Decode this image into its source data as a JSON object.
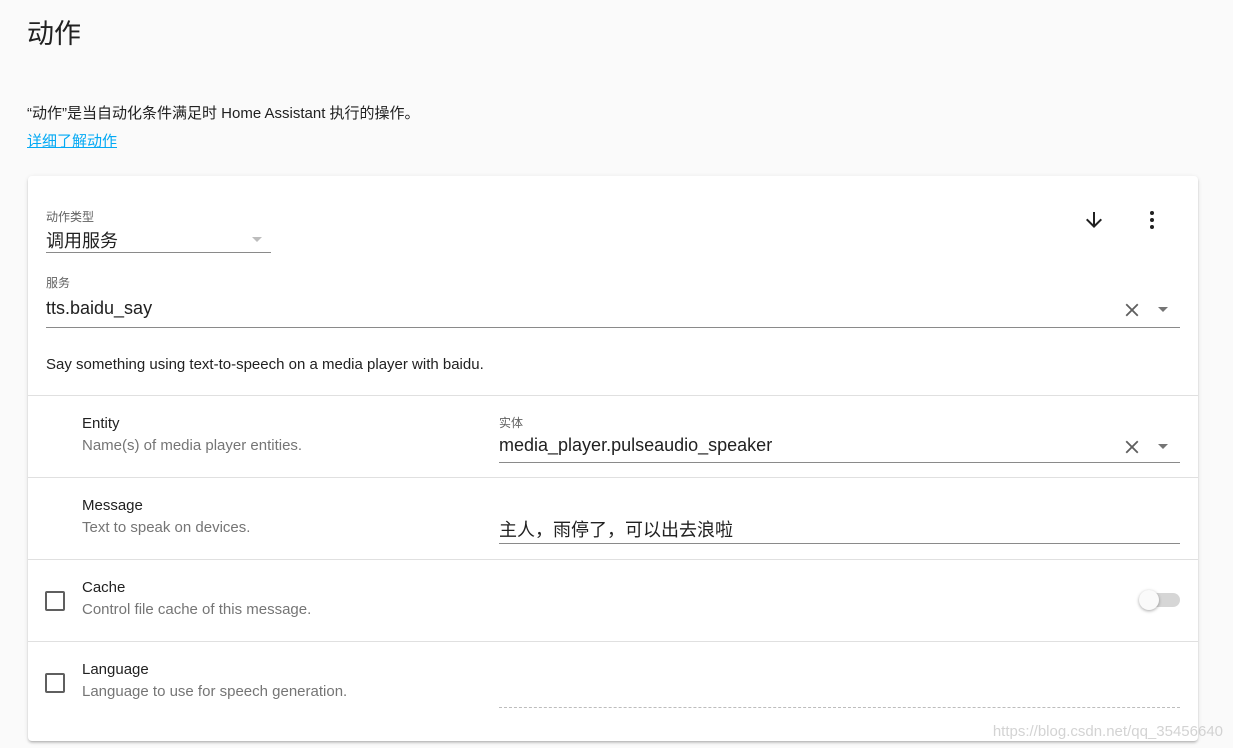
{
  "header": {
    "title": "动作",
    "intro": "“动作”是当自动化条件满足时 Home Assistant 执行的操作。",
    "learn_more": "详细了解动作"
  },
  "action": {
    "type_label": "动作类型",
    "type_value": "调用服务",
    "service_label": "服务",
    "service_value": "tts.baidu_say",
    "description": "Say something using text-to-speech on a media player with baidu."
  },
  "fields": {
    "entity": {
      "title": "Entity",
      "desc": "Name(s) of media player entities.",
      "input_label": "实体",
      "input_value": "media_player.pulseaudio_speaker"
    },
    "message": {
      "title": "Message",
      "desc": "Text to speak on devices.",
      "input_value": "主人，雨停了，可以出去浪啦"
    },
    "cache": {
      "title": "Cache",
      "desc": "Control file cache of this message.",
      "checked": false,
      "toggle_on": false
    },
    "language": {
      "title": "Language",
      "desc": "Language to use for speech generation.",
      "checked": false
    }
  },
  "icons": {
    "move_down": "arrow-down-icon",
    "menu": "dots-vertical-icon",
    "clear": "close-icon",
    "dropdown": "menu-down-icon"
  },
  "watermark": "https://blog.csdn.net/qq_35456640"
}
